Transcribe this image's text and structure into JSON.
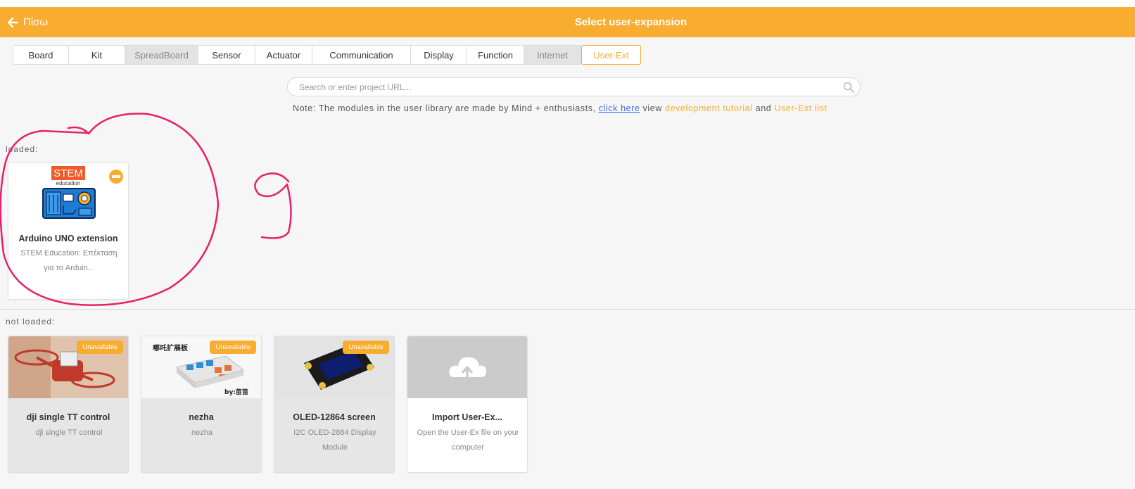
{
  "header": {
    "back_label": "Πίσω",
    "title": "Select user-expansion"
  },
  "tabs": [
    {
      "label": "Board",
      "state": "normal"
    },
    {
      "label": "Kit",
      "state": "normal"
    },
    {
      "label": "SpreadBoard",
      "state": "dim"
    },
    {
      "label": "Sensor",
      "state": "normal"
    },
    {
      "label": "Actuator",
      "state": "normal"
    },
    {
      "label": "Communication",
      "state": "normal"
    },
    {
      "label": "Display",
      "state": "normal"
    },
    {
      "label": "Function",
      "state": "normal"
    },
    {
      "label": "Internet",
      "state": "dim"
    },
    {
      "label": "User-Ext",
      "state": "active"
    }
  ],
  "search": {
    "placeholder": "Search or enter project URL..."
  },
  "note": {
    "text": "Note: The modules in the user library are made by Mind + enthusiasts, ",
    "link1": "click here",
    "mid": " view ",
    "link2": "development tutorial",
    "and": " and ",
    "link3": "User-Ext list"
  },
  "loaded": {
    "label": "loaded:",
    "items": [
      {
        "title": "Arduino UNO extension",
        "desc": "STEM Education: Επέκταση για το Arduin...",
        "logo_top": "STEM",
        "logo_sub": "education"
      }
    ]
  },
  "not_loaded": {
    "label": "not loaded:",
    "items": [
      {
        "title": "dji single TT control",
        "desc": "dji single TT control",
        "badge": "Unavailable"
      },
      {
        "title": "nezha",
        "desc": "nezha",
        "badge": "Unavailable",
        "img_text_top": "哪吒扩展板",
        "img_text_bottom": "by:苗苗"
      },
      {
        "title": "OLED-12864 screen",
        "desc": "I2C OLED-2864 Display Module",
        "badge": "Unavailable"
      },
      {
        "title": "Import User-Ex...",
        "desc": "Open the User-Ex file on your computer"
      }
    ]
  },
  "colors": {
    "accent": "#f8ac30",
    "link": "#3a6ee8",
    "annotation": "#e8206a"
  },
  "icons": {
    "back": "arrow-left-icon",
    "search": "search-icon",
    "remove": "minus-circle-icon",
    "upload": "cloud-upload-icon"
  }
}
